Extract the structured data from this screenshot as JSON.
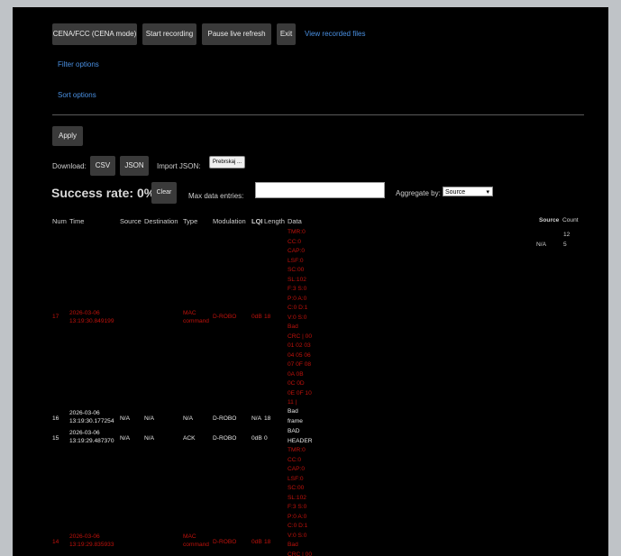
{
  "toolbar": {
    "cena_label": "CENA/FCC (CENA mode)",
    "record_label": "Start recording",
    "pause_label": "Pause live refresh",
    "exit_label": "Exit",
    "view_files_label": "View recorded files"
  },
  "filter_label": "Filter options",
  "sort_label": "Sort options",
  "apply_label": "Apply",
  "download": {
    "label": "Download:",
    "csv": "CSV",
    "json": "JSON",
    "import_label": "Import JSON:",
    "browse_label": "Prebrskaj ..."
  },
  "stats": {
    "success_rate": "Success rate: 0%",
    "clear_label": "Clear",
    "max_entries_label": "Max data entries:",
    "max_entries_value": "",
    "aggregate_label": "Aggregate by:",
    "aggregate_value": "Source"
  },
  "table": {
    "headers": [
      "Num",
      "Time",
      "Source",
      "Destination",
      "Type",
      "Modulation",
      "LQI",
      "Length",
      "Data"
    ],
    "rows": [
      {
        "num": "17",
        "time1": "2026-03-06",
        "time2": "13:19:30.849199",
        "source": "",
        "destination": "",
        "type1": "MAC",
        "type2": "command",
        "modulation": "D-ROBO",
        "lqi": "0dB",
        "length": "18",
        "data": "TMR:0\nCC:0\nCAP:0\nLSF:0\nSC:00\nSL:102\nF:3 S:0\nP:0 A:0\nC:0 D:1\nV:0 S:0\nBad\nCRC | 00\n01 02 03\n04 05 06\n07 0F 08\n0A 0B\n0C 0D\n0E 0F 10\n11 |"
      },
      {
        "num": "16",
        "time1": "2026-03-06",
        "time2": "13:19:30.177254",
        "source": "N/A",
        "destination": "N/A",
        "type1": "N/A",
        "type2": "",
        "modulation": "D-ROBO",
        "lqi": "N/A",
        "length": "18",
        "data": "Bad\nframe"
      },
      {
        "num": "15",
        "time1": "2026-03-06",
        "time2": "13:19:29.487370",
        "source": "N/A",
        "destination": "N/A",
        "type1": "ACK",
        "type2": "",
        "modulation": "D-ROBO",
        "lqi": "0dB",
        "length": "0",
        "data": "BAD\nHEADER"
      },
      {
        "num": "14",
        "time1": "2026-03-06",
        "time2": "13:19:29.835933",
        "source": "",
        "destination": "",
        "type1": "MAC",
        "type2": "command",
        "modulation": "D-ROBO",
        "lqi": "0dB",
        "length": "18",
        "data": "TMR:0\nCC:0\nCAP:0\nLSF:0\nSC:00\nSL:102\nF:3 S:0\nP:0 A:0\nC:0 D:1\nV:0 S:0\nBad\nCRC | 00"
      }
    ]
  },
  "aggregate_table": {
    "headers": [
      "Source",
      "Count"
    ],
    "rows": [
      {
        "source": "",
        "count": "12"
      },
      {
        "source": "N/A",
        "count": "5"
      }
    ]
  },
  "colors": {
    "background": "#000000",
    "button": "#3a3a3a",
    "link": "#4a90e2",
    "error_row": "#c0120c"
  }
}
